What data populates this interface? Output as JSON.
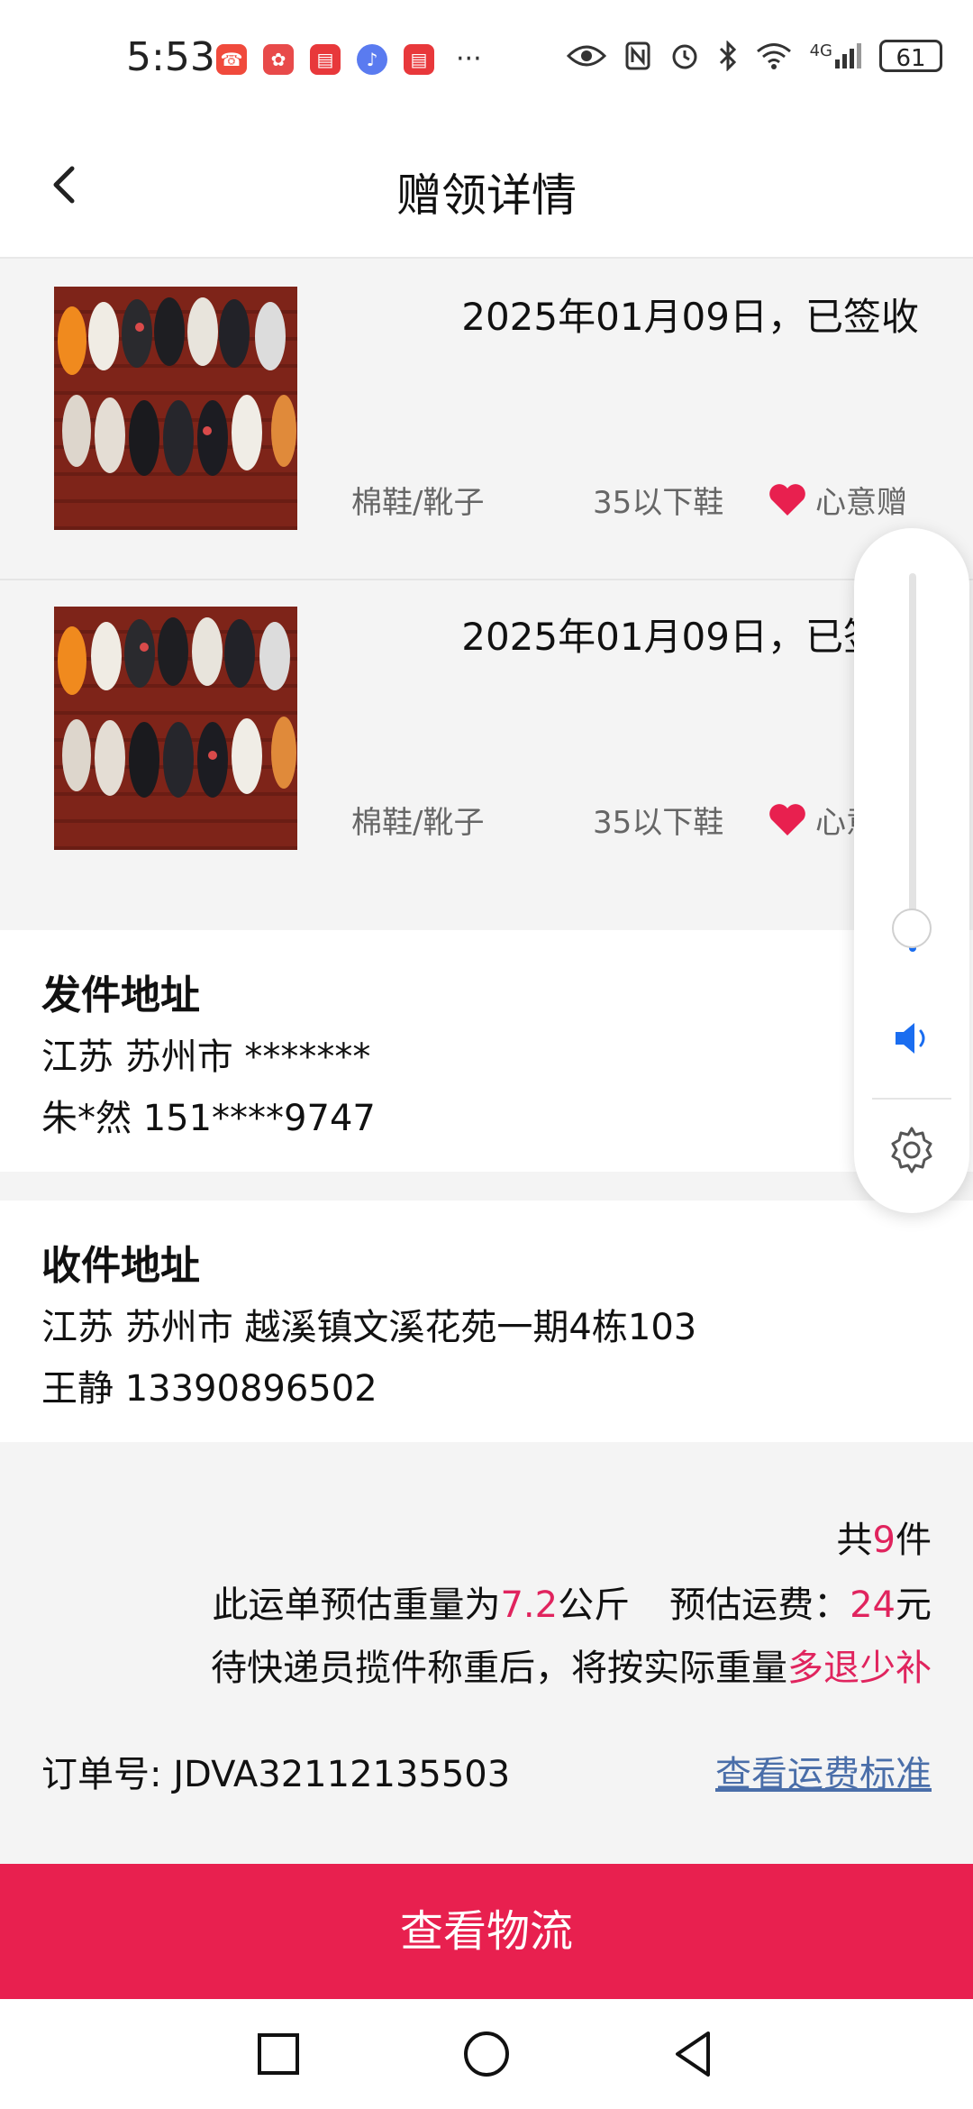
{
  "status_bar": {
    "time": "5:53",
    "apps": [
      {
        "icon": "phone-app-icon",
        "color": "#f04a3c"
      },
      {
        "icon": "huawei-app-icon",
        "color": "#e84a4a"
      },
      {
        "icon": "reader-app-icon",
        "color": "#e8383b"
      },
      {
        "icon": "music-app-icon",
        "color": "#5a7bf0"
      },
      {
        "icon": "reader-app-icon-2",
        "color": "#e8383b"
      }
    ],
    "more": "···",
    "network": "4G",
    "battery": "61"
  },
  "header": {
    "title": "赠领详情"
  },
  "items": [
    {
      "date_status": "2025年01月09日，已签收",
      "category": "棉鞋/靴子",
      "size": "35以下鞋",
      "tag": "心意赠"
    },
    {
      "date_status": "2025年01月09日，已签收",
      "category": "棉鞋/靴子",
      "size": "35以下鞋",
      "tag": "心意赠"
    }
  ],
  "sender": {
    "title": "发件地址",
    "address": "江苏 苏州市 *******",
    "contact": "朱*然 151****9747"
  },
  "receiver": {
    "title": "收件地址",
    "address": "江苏 苏州市 越溪镇文溪花苑一期4栋103",
    "contact": "王静 13390896502"
  },
  "summary": {
    "count_prefix": "共",
    "count": "9",
    "count_suffix": "件",
    "weight_prefix": "此运单预估重量为",
    "weight": "7.2",
    "weight_unit": "公斤",
    "fee_prefix": "预估运费：",
    "fee": "24",
    "fee_unit": "元",
    "note_prefix": "待快递员揽件称重后，将按实际重量",
    "note_highlight": "多退少补",
    "order_label": "订单号:",
    "order_no": "JDVA32112135503",
    "fee_link": "查看运费标准"
  },
  "button": {
    "label": "查看物流"
  },
  "colors": {
    "accent": "#e8204f",
    "highlight": "#e0245e",
    "link": "#4a6ea9"
  },
  "volume_level": 0.02
}
